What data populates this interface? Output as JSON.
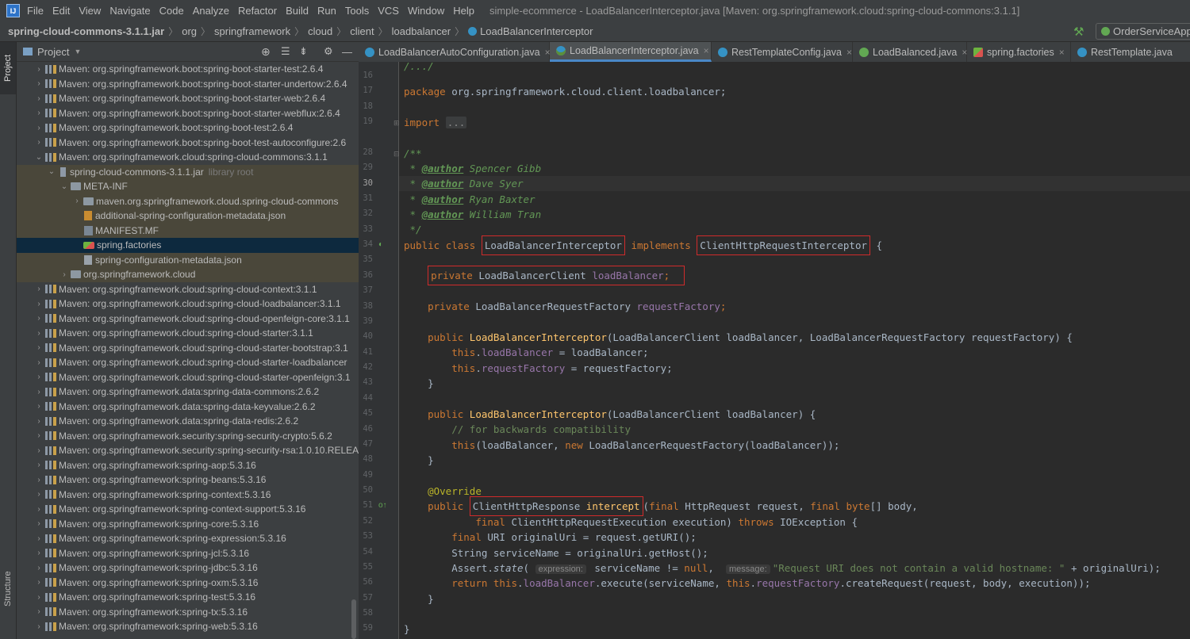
{
  "menubar": {
    "logo": "IJ",
    "items": [
      "File",
      "Edit",
      "View",
      "Navigate",
      "Code",
      "Analyze",
      "Refactor",
      "Build",
      "Run",
      "Tools",
      "VCS",
      "Window",
      "Help"
    ],
    "title": "simple-ecommerce - LoadBalancerInterceptor.java [Maven: org.springframework.cloud:spring-cloud-commons:3.1.1]"
  },
  "navbar": {
    "crumbs": [
      "spring-cloud-commons-3.1.1.jar",
      "org",
      "springframework",
      "cloud",
      "client",
      "loadbalancer",
      "LoadBalancerInterceptor"
    ],
    "run_config": "OrderServiceApp"
  },
  "leftstrip": {
    "project_tab": "Project",
    "structure_tab": "Structure"
  },
  "project_header": {
    "title": "Project"
  },
  "tree": [
    {
      "text": "Maven: org.springframework.boot:spring-boot-starter-test:2.6.4"
    },
    {
      "text": "Maven: org.springframework.boot:spring-boot-starter-undertow:2.6.4"
    },
    {
      "text": "Maven: org.springframework.boot:spring-boot-starter-web:2.6.4"
    },
    {
      "text": "Maven: org.springframework.boot:spring-boot-starter-webflux:2.6.4"
    },
    {
      "text": "Maven: org.springframework.boot:spring-boot-test:2.6.4"
    },
    {
      "text": "Maven: org.springframework.boot:spring-boot-test-autoconfigure:2.6"
    },
    {
      "text": "Maven: org.springframework.cloud:spring-cloud-commons:3.1.1"
    },
    {
      "text": "spring-cloud-commons-3.1.1.jar",
      "extra": "library root"
    },
    {
      "text": "META-INF"
    },
    {
      "text": "maven.org.springframework.cloud.spring-cloud-commons"
    },
    {
      "text": "additional-spring-configuration-metadata.json"
    },
    {
      "text": "MANIFEST.MF"
    },
    {
      "text": "spring.factories"
    },
    {
      "text": "spring-configuration-metadata.json"
    },
    {
      "text": "org.springframework.cloud"
    },
    {
      "text": "Maven: org.springframework.cloud:spring-cloud-context:3.1.1"
    },
    {
      "text": "Maven: org.springframework.cloud:spring-cloud-loadbalancer:3.1.1"
    },
    {
      "text": "Maven: org.springframework.cloud:spring-cloud-openfeign-core:3.1.1"
    },
    {
      "text": "Maven: org.springframework.cloud:spring-cloud-starter:3.1.1"
    },
    {
      "text": "Maven: org.springframework.cloud:spring-cloud-starter-bootstrap:3.1"
    },
    {
      "text": "Maven: org.springframework.cloud:spring-cloud-starter-loadbalancer"
    },
    {
      "text": "Maven: org.springframework.cloud:spring-cloud-starter-openfeign:3.1"
    },
    {
      "text": "Maven: org.springframework.data:spring-data-commons:2.6.2"
    },
    {
      "text": "Maven: org.springframework.data:spring-data-keyvalue:2.6.2"
    },
    {
      "text": "Maven: org.springframework.data:spring-data-redis:2.6.2"
    },
    {
      "text": "Maven: org.springframework.security:spring-security-crypto:5.6.2"
    },
    {
      "text": "Maven: org.springframework.security:spring-security-rsa:1.0.10.RELEA"
    },
    {
      "text": "Maven: org.springframework:spring-aop:5.3.16"
    },
    {
      "text": "Maven: org.springframework:spring-beans:5.3.16"
    },
    {
      "text": "Maven: org.springframework:spring-context:5.3.16"
    },
    {
      "text": "Maven: org.springframework:spring-context-support:5.3.16"
    },
    {
      "text": "Maven: org.springframework:spring-core:5.3.16"
    },
    {
      "text": "Maven: org.springframework:spring-expression:5.3.16"
    },
    {
      "text": "Maven: org.springframework:spring-jcl:5.3.16"
    },
    {
      "text": "Maven: org.springframework:spring-jdbc:5.3.16"
    },
    {
      "text": "Maven: org.springframework:spring-oxm:5.3.16"
    },
    {
      "text": "Maven: org.springframework:spring-test:5.3.16"
    },
    {
      "text": "Maven: org.springframework:spring-tx:5.3.16"
    },
    {
      "text": "Maven: org.springframework:spring-web:5.3.16"
    }
  ],
  "tabs": [
    {
      "label": "LoadBalancerAutoConfiguration.java"
    },
    {
      "label": "LoadBalancerInterceptor.java"
    },
    {
      "label": "RestTemplateConfig.java"
    },
    {
      "label": "LoadBalanced.java"
    },
    {
      "label": "spring.factories"
    },
    {
      "label": "RestTemplate.java"
    }
  ],
  "line_numbers": [
    "16",
    "17",
    "18",
    "19",
    "28",
    "29",
    "30",
    "31",
    "32",
    "33",
    "34",
    "35",
    "36",
    "37",
    "38",
    "39",
    "40",
    "41",
    "42",
    "43",
    "44",
    "45",
    "46",
    "47",
    "48",
    "49",
    "50",
    "51",
    "52",
    "53",
    "54",
    "55",
    "56",
    "57",
    "58",
    "59"
  ],
  "code": {
    "package": "package",
    "package_name": " org.springframework.cloud.client.loadbalancer;",
    "import": "import",
    "import_fold": "...",
    "doc_open": "/**",
    "star": " * ",
    "author_tag": "@author",
    "authors": [
      " Spencer Gibb",
      " Dave Syer",
      " Ryan Baxter",
      " William Tran"
    ],
    "doc_close": " */",
    "public": "public",
    "class": "class",
    "class_name": "LoadBalancerInterceptor",
    "implements": "implements",
    "iface": "ClientHttpRequestInterceptor",
    "brace_open": " {",
    "private": "private",
    "lbc_type": " LoadBalancerClient ",
    "lb_field": "loadBalancer",
    "semi": ";",
    "lbrf_type": " LoadBalancerRequestFactory ",
    "rf_field": "requestFactory",
    "ctor_params1": "(LoadBalancerClient loadBalancer, LoadBalancerRequestFactory requestFactory) {",
    "this": "this",
    "assign_lb": " = loadBalancer;",
    "assign_rf": " = requestFactory;",
    "close_brace": "}",
    "ctor_params2": "(LoadBalancerClient loadBalancer) {",
    "comment_compat": "// for backwards compatibility",
    "this_call_a": "(loadBalancer, ",
    "new": "new",
    "this_call_b": " LoadBalancerRequestFactory(loadBalancer));",
    "override": "@Override",
    "resp_type": "ClientHttpResponse",
    "intercept": "intercept",
    "final": "final",
    "params_a": " HttpRequest request, ",
    "byte": "byte",
    "params_b": "[] body,",
    "params_c": " ClientHttpRequestExecution execution) ",
    "throws": "throws",
    "params_d": " IOException {",
    "uri_line": " URI originalUri = request.getURI();",
    "svc_line": "String serviceName = originalUri.getHost();",
    "assert_a": "Assert.",
    "assert_state": "state",
    "hint_expression": "expression:",
    "assert_b": " serviceName != ",
    "null": "null",
    "hint_message": "message:",
    "assert_msg": "\"Request URI does not contain a valid hostname: \"",
    "assert_c": " + originalUri);",
    "return": "return",
    "exec_a": ".",
    "exec_b": ".execute(serviceName, ",
    "exec_c": ".createRequest(request, body, execution));"
  }
}
